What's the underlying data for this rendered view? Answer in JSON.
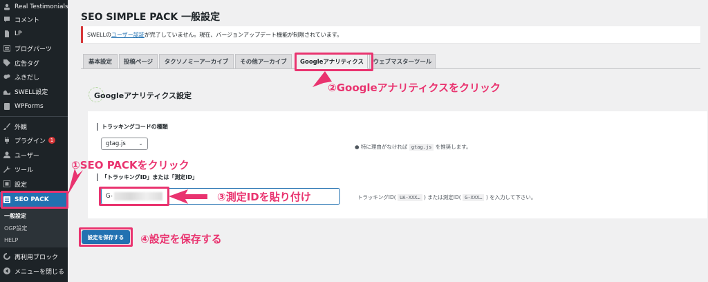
{
  "sidebar": {
    "items": [
      {
        "label": "Real Testimonials",
        "icon": "testimonial-icon"
      },
      {
        "label": "コメント",
        "icon": "comment-icon"
      },
      {
        "label": "LP",
        "icon": "page-icon"
      },
      {
        "label": "ブログパーツ",
        "icon": "blocks-icon"
      },
      {
        "label": "広告タグ",
        "icon": "tag-icon"
      },
      {
        "label": "ふきだし",
        "icon": "speech-bubble-icon"
      },
      {
        "label": "SWELL設定",
        "icon": "swell-icon"
      },
      {
        "label": "WPForms",
        "icon": "form-icon"
      },
      {
        "label": "外観",
        "icon": "paintbrush-icon"
      },
      {
        "label": "プラグイン",
        "icon": "plugin-icon",
        "badge": "1"
      },
      {
        "label": "ユーザー",
        "icon": "user-icon"
      },
      {
        "label": "ツール",
        "icon": "wrench-icon"
      },
      {
        "label": "設定",
        "icon": "settings-icon"
      },
      {
        "label": "SEO PACK",
        "icon": "seo-pack-icon"
      },
      {
        "label": "再利用ブロック",
        "icon": "reusable-block-icon"
      },
      {
        "label": "メニューを閉じる",
        "icon": "collapse-icon"
      }
    ],
    "submenu": [
      "一般設定",
      "OGP設定",
      "HELP"
    ]
  },
  "page": {
    "title": "SEO SIMPLE PACK 一般設定",
    "notice_prefix": "SWELLの",
    "notice_link": "ユーザー認証",
    "notice_suffix": "が完了していません。現在、バージョンアップデート機能が制限されています。"
  },
  "tabs": [
    "基本設定",
    "投稿ページ",
    "タクソノミーアーカイブ",
    "その他アーカイブ",
    "Googleアナリティクス",
    "ウェブマスターツール"
  ],
  "section": {
    "heading": "Googleアナリティクス設定",
    "tracking_type_label": "トラッキングコードの種類",
    "tracking_type_value": "gtag.js",
    "tracking_type_hint_pre": "特に理由がなければ",
    "tracking_type_hint_code": "gtag.js",
    "tracking_type_hint_post": "を推奨します。",
    "id_label": "「トラッキングID」または「測定ID」",
    "id_value": "G-",
    "id_hint_1": "トラッキングID(",
    "id_hint_code1": "UA-XXX…",
    "id_hint_2": ") または測定ID(",
    "id_hint_code2": "G-XXX…",
    "id_hint_3": ") を入力して下さい。"
  },
  "save_label": "設定を保存する",
  "annotations": {
    "step1": "①SEO PACKをクリック",
    "step2": "②Googleアナリティクスをクリック",
    "step3": "③測定IDを貼り付け",
    "step4": "④設定を保存する"
  },
  "colors": {
    "accent": "#2271b1",
    "annotation": "#e9336f",
    "sidebar": "#1d2327"
  }
}
